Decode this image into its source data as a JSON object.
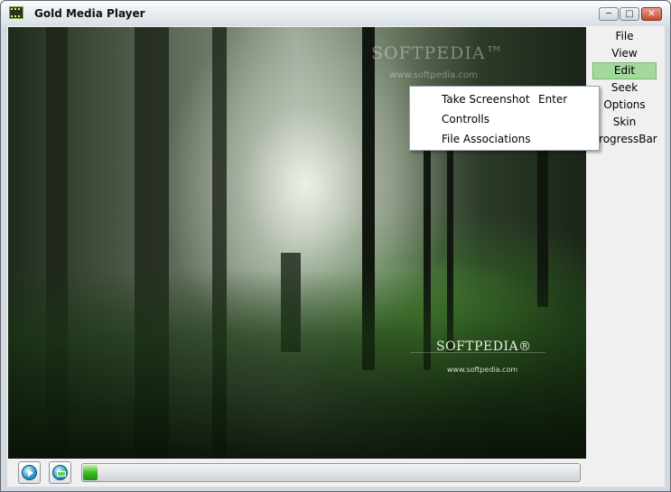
{
  "window": {
    "title": "Gold Media Player",
    "controls": {
      "minimize": "─",
      "maximize": "□",
      "close": "✕"
    },
    "close_color": "#c74a31"
  },
  "video": {
    "watermark_top": "SOFTPEDIA™",
    "watermark_top_url": "www.softpedia.com",
    "watermark_main": "SOFTPEDIA®",
    "watermark_url": "www.softpedia.com"
  },
  "menu": {
    "items": [
      {
        "label": "File"
      },
      {
        "label": "View"
      },
      {
        "label": "Edit",
        "active": true
      },
      {
        "label": "Seek"
      },
      {
        "label": "Options"
      },
      {
        "label": "Skin"
      },
      {
        "label": "ProgressBar"
      }
    ],
    "active_color": "#a4d99d"
  },
  "edit_menu": {
    "items": [
      {
        "label": "Take Screenshot",
        "shortcut": "Enter"
      },
      {
        "label": "Controlls",
        "shortcut": ""
      },
      {
        "label": "File Associations",
        "shortcut": ""
      }
    ]
  },
  "controls": {
    "play_icon": "play-icon",
    "stop_icon": "stop-icon",
    "progress_fraction": 0.03,
    "progress_color": "#3dbb1f"
  }
}
